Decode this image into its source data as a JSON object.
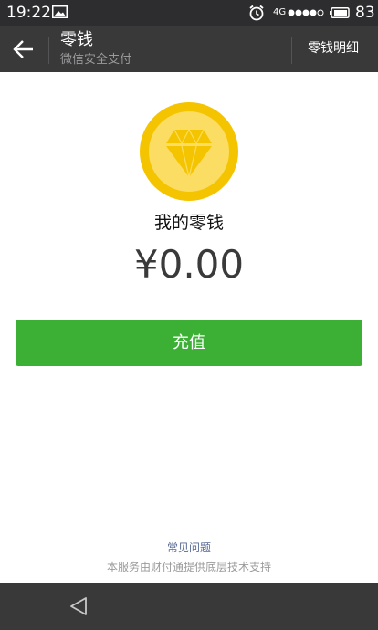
{
  "status_bar": {
    "time": "19:22",
    "network": "4G",
    "battery_percent": "83",
    "icons": [
      "image-icon",
      "alarm-icon",
      "signal-dots-icon",
      "battery-icon"
    ]
  },
  "header": {
    "title": "零钱",
    "subtitle": "微信安全支付",
    "right_action": "零钱明细",
    "back_icon": "arrow-left-icon"
  },
  "wallet": {
    "icon": "diamond-coin-icon",
    "label": "我的零钱",
    "balance": "¥0.00"
  },
  "actions": {
    "recharge_label": "充值"
  },
  "footer": {
    "faq_link": "常见问题",
    "support_text": "本服务由财付通提供底层技术支持"
  },
  "nav_bar": {
    "back_icon": "triangle-back-icon"
  },
  "colors": {
    "status_bar_bg": "#2d2d2f",
    "header_bg": "#39393a",
    "button_green": "#3cb034",
    "link_blue": "#576b95",
    "coin_gold": "#f5c400"
  }
}
